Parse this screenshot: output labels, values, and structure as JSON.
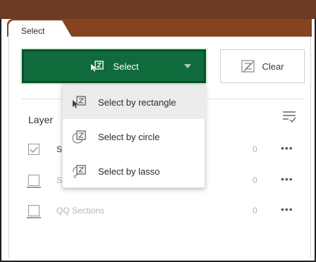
{
  "panel_tab": {
    "label": "Select"
  },
  "toolbar": {
    "select_label": "Select",
    "select_icon": "select-rectangle-icon",
    "clear_label": "Clear",
    "clear_icon": "clear-selection-icon"
  },
  "layers": {
    "heading": "Layer",
    "sort_icon": "sort-icon",
    "rows": [
      {
        "name": "S",
        "count": "0",
        "checked": true,
        "enabled": true
      },
      {
        "name": "S",
        "count": "0",
        "checked": false,
        "enabled": false
      },
      {
        "name": "QQ Sections",
        "count": "0",
        "checked": false,
        "enabled": false
      }
    ],
    "more_label": "•••"
  },
  "select_menu": {
    "items": [
      {
        "label": "Select by rectangle",
        "icon": "select-rectangle-icon",
        "active": true
      },
      {
        "label": "Select by circle",
        "icon": "select-circle-icon",
        "active": false
      },
      {
        "label": "Select by lasso",
        "icon": "select-lasso-icon",
        "active": false
      }
    ]
  },
  "colors": {
    "header_brown": "#6d3a24",
    "tab_brown": "#864320",
    "select_green": "#0f6b3c",
    "disabled_text": "#b4b4b4"
  }
}
